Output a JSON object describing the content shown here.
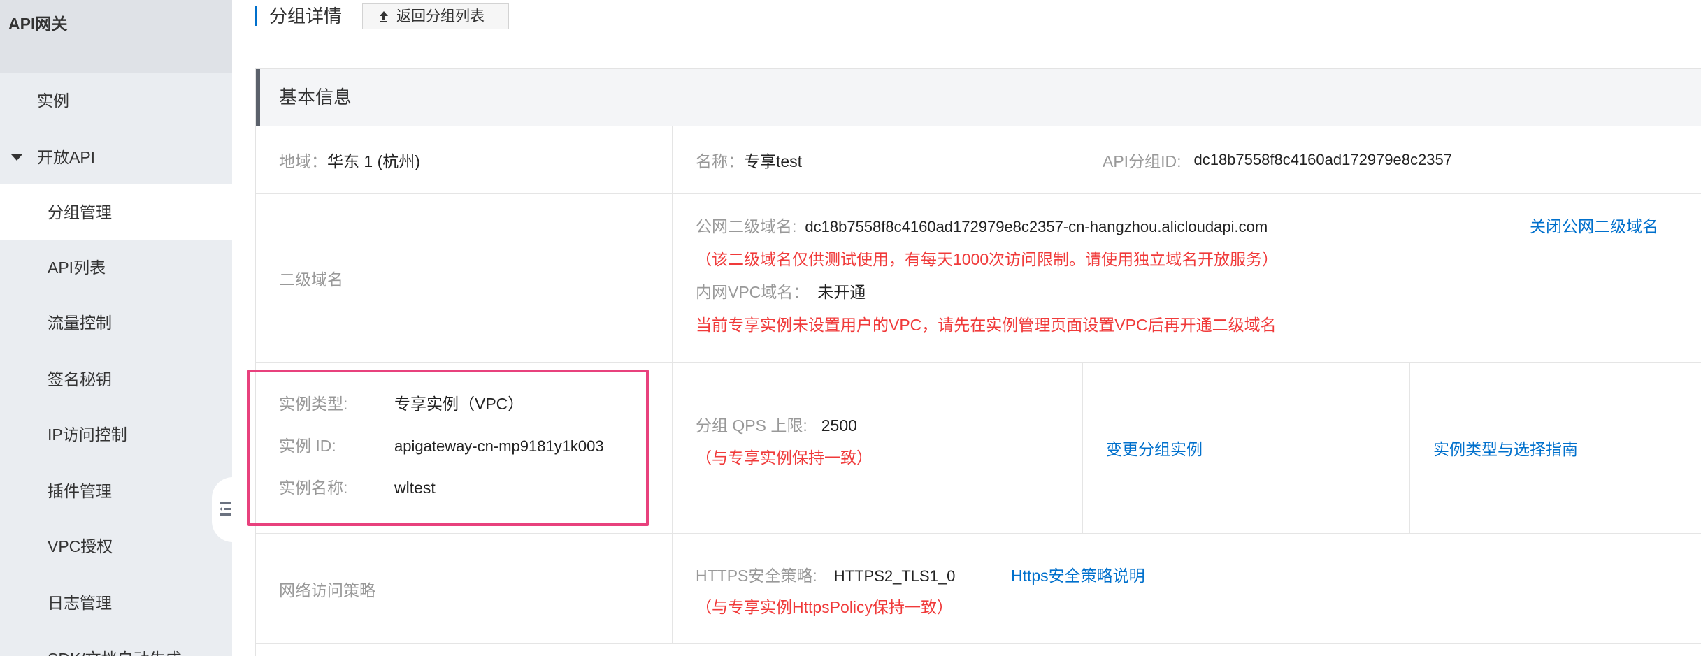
{
  "app": {
    "title": "API网关"
  },
  "icons": {
    "expand": "caret-down-icon",
    "collapse_sidebar": "collapse-sidebar-icon",
    "back": "upload-arrow-icon"
  },
  "colors": {
    "link": "#0070cc",
    "warning": "#f03a3a",
    "highlight_box": "#e8417d",
    "title_accent": "#0070cc"
  },
  "sidebar": {
    "items": [
      {
        "label": "实例"
      },
      {
        "label": "开放API",
        "expanded": true
      },
      {
        "label": "分组管理",
        "active": true
      },
      {
        "label": "API列表"
      },
      {
        "label": "流量控制"
      },
      {
        "label": "签名秘钥"
      },
      {
        "label": "IP访问控制"
      },
      {
        "label": "插件管理"
      },
      {
        "label": "VPC授权"
      },
      {
        "label": "日志管理"
      },
      {
        "label": "SDK/文档自动生成"
      }
    ]
  },
  "page": {
    "title": "分组详情",
    "back_button": "返回分组列表"
  },
  "basic_info": {
    "title": "基本信息",
    "region": {
      "label": "地域：",
      "value": "华东 1 (杭州)"
    },
    "name": {
      "label": "名称：",
      "value": "专享test"
    },
    "group_id": {
      "label": "API分组ID:",
      "value": "dc18b7558f8c4160ad172979e8c2357"
    },
    "subdomain": {
      "label": "二级域名",
      "public_label": "公网二级域名:",
      "public_value": "dc18b7558f8c4160ad172979e8c2357-cn-hangzhou.alicloudapi.com",
      "close_link": "关闭公网二级域名",
      "public_note": "（该二级域名仅供测试使用，有每天1000次访问限制。请使用独立域名开放服务）",
      "vpc_label": "内网VPC域名：",
      "vpc_value": "未开通",
      "vpc_note": "当前专享实例未设置用户的VPC，请先在实例管理页面设置VPC后再开通二级域名"
    },
    "instance": {
      "type_label": "实例类型:",
      "type_value": "专享实例（VPC）",
      "id_label": "实例 ID:",
      "id_value": "apigateway-cn-mp9181y1k003",
      "name_label": "实例名称:",
      "name_value": "wltest"
    },
    "qps": {
      "label": "分组 QPS 上限:",
      "value": "2500",
      "note": "（与专享实例保持一致）"
    },
    "change_instance_link": "变更分组实例",
    "instance_guide_link": "实例类型与选择指南",
    "network": {
      "label": "网络访问策略",
      "https_label": "HTTPS安全策略:",
      "https_value": "HTTPS2_TLS1_0",
      "https_link": "Https安全策略说明",
      "note": "（与专享实例HttpsPolicy保持一致）"
    }
  }
}
